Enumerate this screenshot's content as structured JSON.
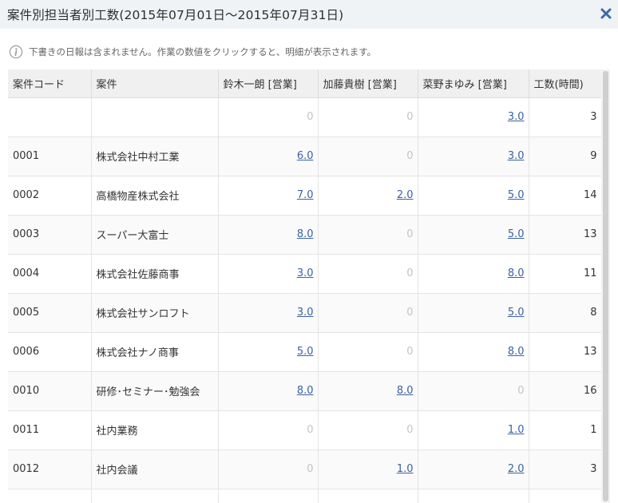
{
  "dialog": {
    "title": "案件別担当者別工数(2015年07月01日～2015年07月31日)",
    "notice": "下書きの日報は含まれません。作業の数値をクリックすると、明細が表示されます。"
  },
  "table": {
    "headers": [
      "案件コード",
      "案件",
      "鈴木一朗 [営業]",
      "加藤貴樹 [営業]",
      "菜野まゆみ [営業]",
      "工数(時間)"
    ],
    "rows": [
      {
        "code": "",
        "name": "",
        "p1": "0",
        "p2": "0",
        "p3": "3.0",
        "total": "3"
      },
      {
        "code": "0001",
        "name": "株式会社中村工業",
        "p1": "6.0",
        "p2": "0",
        "p3": "3.0",
        "total": "9"
      },
      {
        "code": "0002",
        "name": "高橋物産株式会社",
        "p1": "7.0",
        "p2": "2.0",
        "p3": "5.0",
        "total": "14"
      },
      {
        "code": "0003",
        "name": "スーパー大富士",
        "p1": "8.0",
        "p2": "0",
        "p3": "5.0",
        "total": "13"
      },
      {
        "code": "0004",
        "name": "株式会社佐藤商事",
        "p1": "3.0",
        "p2": "0",
        "p3": "8.0",
        "total": "11"
      },
      {
        "code": "0005",
        "name": "株式会社サンロフト",
        "p1": "3.0",
        "p2": "0",
        "p3": "5.0",
        "total": "8"
      },
      {
        "code": "0006",
        "name": "株式会社ナノ商事",
        "p1": "5.0",
        "p2": "0",
        "p3": "8.0",
        "total": "13"
      },
      {
        "code": "0010",
        "name": "研修･セミナー･勉強会",
        "p1": "8.0",
        "p2": "8.0",
        "p3": "0",
        "total": "16"
      },
      {
        "code": "0011",
        "name": "社内業務",
        "p1": "0",
        "p2": "0",
        "p3": "1.0",
        "total": "1"
      },
      {
        "code": "0012",
        "name": "社内会議",
        "p1": "0",
        "p2": "1.0",
        "p3": "2.0",
        "total": "3"
      },
      {
        "code": "",
        "name": "",
        "p1": "",
        "p2": "",
        "p3": "",
        "total": ""
      }
    ]
  },
  "icons": {
    "close": "close-icon",
    "info": "info-icon"
  },
  "colors": {
    "header_bg": "#f0f3f6",
    "close_icon": "#3b6ca8",
    "link": "#3b62a3",
    "zero_value": "#c4c4c4"
  }
}
